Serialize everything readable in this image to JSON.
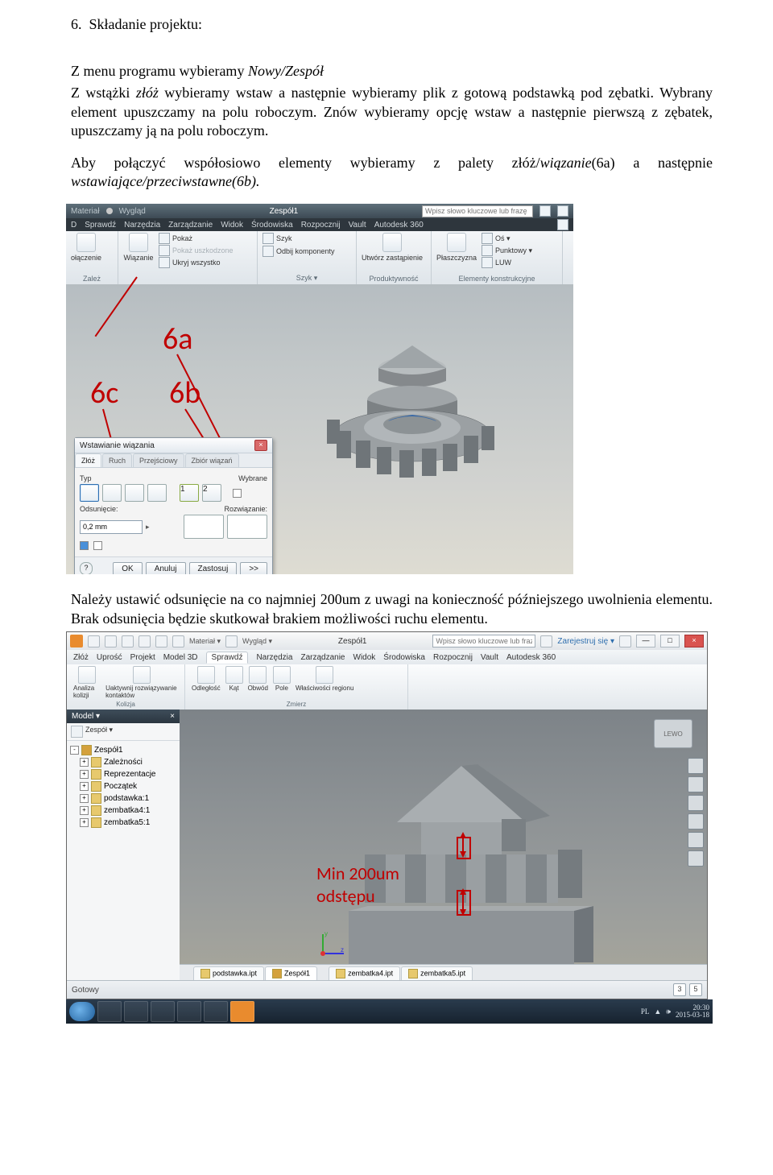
{
  "section_number": "6.",
  "heading": "Składanie projektu:",
  "p1_a": "Z menu programu wybieramy ",
  "p1_i": "Nowy/Zespół",
  "p2_a": "Z wstążki ",
  "p2_i1": "złóż",
  "p2_b": " wybieramy wstaw a następnie wybieramy plik z gotową  podstawką pod zębatki. Wybrany element upuszczamy na polu roboczym. Znów wybieramy opcję wstaw a następnie pierwszą z zębatek, upuszczamy ją na polu roboczym.",
  "p3_a": "Aby połączyć współosiowo elementy wybieramy z palety złóż/",
  "p3_i1": "wiązanie",
  "p3_b": "(6a) a następnie ",
  "p3_i2": "wstawiające/przeciwstawne(6b).",
  "ann": {
    "a": "6a",
    "b": "6b",
    "c": "6c"
  },
  "shot1": {
    "title_left": "Materiał",
    "title_mid": "Wygląd",
    "title_center": "Zespół1",
    "search_ph": "Wpisz słowo kluczowe lub frazę",
    "menus": [
      "Sprawdź",
      "Narzędzia",
      "Zarządzanie",
      "Widok",
      "Środowiska",
      "Rozpocznij",
      "Vault",
      "Autodesk 360"
    ],
    "ribbon": {
      "g1": {
        "btn": "ołączenie",
        "label": "Zależ"
      },
      "g2": {
        "btn": "Wiązanie",
        "lines": [
          "Pokaż",
          "Pokaż uszkodzone",
          "Ukryj wszystko"
        ]
      },
      "g3": {
        "lines": [
          "Szyk",
          "Odbij komponenty"
        ],
        "label": "Szyk ▾"
      },
      "g4": {
        "btn": "Utwórz\nzastąpienie",
        "label": "Produktywność"
      },
      "g5": {
        "btn": "Płaszczyzna",
        "lines": [
          "Oś ▾",
          "Punktowy ▾",
          "LUW"
        ],
        "label": "Elementy konstrukcyjne"
      }
    },
    "dialog": {
      "title": "Wstawianie wiązania",
      "tabs": [
        "Złóż",
        "Ruch",
        "Przejściowy",
        "Zbiór wiązań"
      ],
      "row_typ": "Typ",
      "row_wyb": "Wybrane",
      "row_ods": "Odsunięcie:",
      "row_roz": "Rozwiązanie:",
      "input": "0,2 mm",
      "btn_ok": "OK",
      "btn_cancel": "Anuluj",
      "btn_apply": "Zastosuj",
      "btn_more": ">>"
    }
  },
  "p4": "Należy ustawić odsunięcie na co najmniej 200um z uwagi na konieczność późniejszego uwolnienia elementu. Brak odsunięcia będzie skutkował brakiem możliwości ruchu elementu.",
  "shot2": {
    "search_ph": "Wpisz słowo kluczowe lub frazę",
    "signin": "Zarejestruj się ▾",
    "menus": [
      "Złóż",
      "Uprość",
      "Projekt",
      "Model 3D",
      "Sprawdź",
      "Narzędzia",
      "Zarządzanie",
      "Widok",
      "Środowiska",
      "Rozpocznij",
      "Vault",
      "Autodesk 360"
    ],
    "ribbon": {
      "g1": {
        "btns": [
          "Analiza\nkolizji",
          "Uaktywnij\nrozwiązywanie kontaktów"
        ],
        "label": "Kolizja"
      },
      "g2": {
        "btns": [
          "Odległość",
          "Kąt",
          "Obwód",
          "Pole",
          "Właściwości regionu"
        ],
        "label": "Zmierz"
      }
    },
    "browser": {
      "title": "Model ▾",
      "filter": "Zespół ▾",
      "root": "Zespół1",
      "nodes": [
        "Zależności",
        "Reprezentacje",
        "Początek",
        "podstawka:1",
        "zembatka4:1",
        "zembatka5:1"
      ]
    },
    "viewcube": "LEWO",
    "offset": {
      "l1": "Min 200um",
      "l2": "odstępu"
    },
    "tabs": [
      "podstawka.ipt",
      "Zespół1",
      "zembatka4.ipt",
      "zembatka5.ipt"
    ],
    "status_left": "Gotowy",
    "status_right": {
      "a": "3",
      "b": "5"
    },
    "taskbar": {
      "lang": "PL",
      "time": "20:30",
      "date": "2015-03-18"
    }
  }
}
